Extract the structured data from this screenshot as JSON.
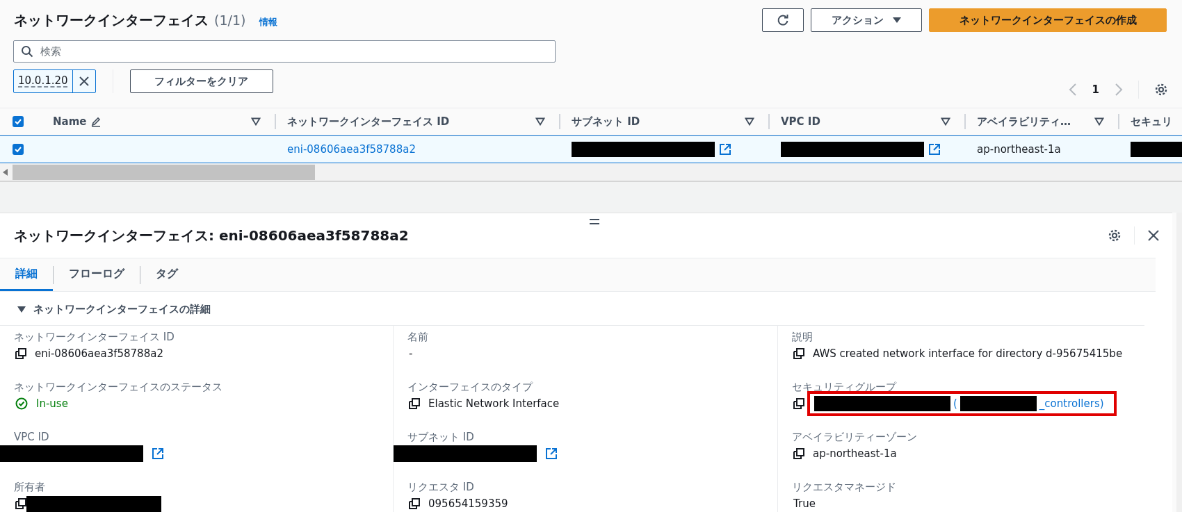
{
  "header": {
    "title": "ネットワークインターフェイス",
    "count": "(1/1)",
    "info_link": "情報"
  },
  "actions": {
    "actions_button": "アクション",
    "create_button": "ネットワークインターフェイスの作成"
  },
  "search": {
    "placeholder": "検索"
  },
  "filter_tokens": [
    {
      "value": "10.0.1.20"
    }
  ],
  "clear_filters": "フィルターをクリア",
  "pagination": {
    "page": "1"
  },
  "table": {
    "select_all_checked": true,
    "columns": [
      {
        "label": "Name",
        "kind": "editable"
      },
      {
        "label": "ネットワークインターフェイス ID",
        "kind": "sortable"
      },
      {
        "label": "サブネット ID",
        "kind": "sortable"
      },
      {
        "label": "VPC ID",
        "kind": "sortable"
      },
      {
        "label": "アベイラビリティ…",
        "kind": "sortable"
      },
      {
        "label": "セキュリ",
        "kind": "plain"
      }
    ],
    "rows": [
      {
        "selected": true,
        "cells": [
          {
            "kind": "empty"
          },
          {
            "kind": "link",
            "text": "eni-08606aea3f58788a2"
          },
          {
            "kind": "redacted_link"
          },
          {
            "kind": "redacted_link"
          },
          {
            "kind": "text",
            "text": "ap-northeast-1a"
          },
          {
            "kind": "redacted"
          }
        ]
      }
    ]
  },
  "detail": {
    "title": "ネットワークインターフェイス: eni-08606aea3f58788a2",
    "tabs": [
      {
        "label": "詳細",
        "selected": true
      },
      {
        "label": "フローログ",
        "selected": false
      },
      {
        "label": "タグ",
        "selected": false
      }
    ],
    "section": {
      "title": "ネットワークインターフェイスの詳細",
      "expanded": true
    },
    "columns": [
      [
        {
          "label": "ネットワークインターフェイス ID",
          "kind": "copy",
          "value": "eni-08606aea3f58788a2"
        },
        {
          "label": "ネットワークインターフェイスのステータス",
          "kind": "status",
          "value": "In-use"
        },
        {
          "label": "VPC ID",
          "kind": "redacted_link"
        },
        {
          "label": "所有者",
          "kind": "redacted_copy"
        }
      ],
      [
        {
          "label": "名前",
          "kind": "plain",
          "value": "-"
        },
        {
          "label": "インターフェイスのタイプ",
          "kind": "copy",
          "value": "Elastic Network Interface"
        },
        {
          "label": "サブネット ID",
          "kind": "redacted_link"
        },
        {
          "label": "リクエスタ ID",
          "kind": "copy",
          "value": "095654159359"
        }
      ],
      [
        {
          "label": "説明",
          "kind": "copy",
          "value": "AWS created network interface for directory d-95675415be"
        },
        {
          "label": "セキュリティグループ",
          "kind": "security_group",
          "prefix": "(",
          "suffix": "_controllers)",
          "highlighted": true
        },
        {
          "label": "アベイラビリティーゾーン",
          "kind": "copy",
          "value": "ap-northeast-1a"
        },
        {
          "label": "リクエスタマネージド",
          "kind": "plain",
          "value": "True"
        }
      ]
    ]
  }
}
